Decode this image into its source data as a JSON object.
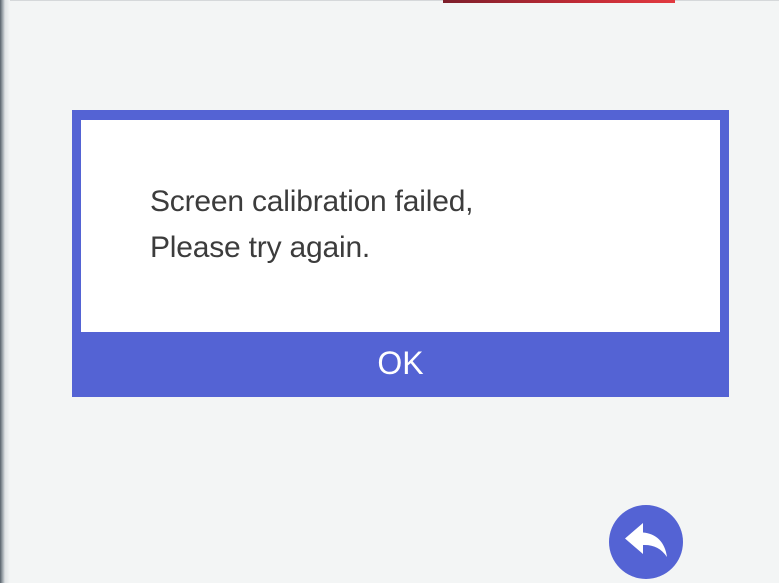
{
  "dialog": {
    "message_line1": "Screen calibration failed,",
    "message_line2": "Please try again.",
    "ok_label": "OK"
  },
  "navigation": {
    "back_icon": "back-arrow-icon"
  },
  "colors": {
    "accent": "#5463d4",
    "background": "#f3f5f5",
    "dialog_body": "#ffffff",
    "message_text": "#3c3c3c",
    "top_strip": "#c12b36"
  }
}
